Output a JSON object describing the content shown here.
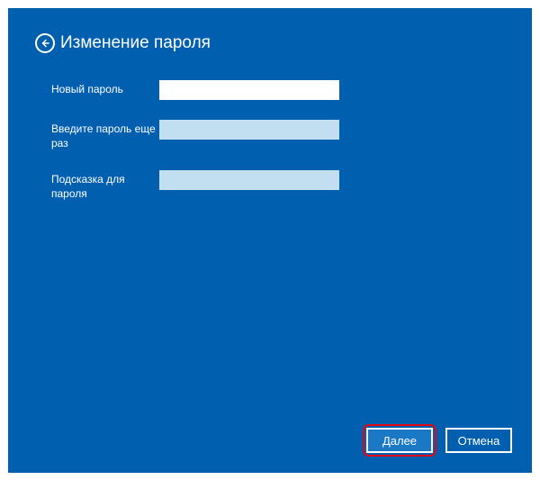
{
  "header": {
    "title": "Изменение пароля"
  },
  "form": {
    "new_password": {
      "label": "Новый пароль",
      "value": ""
    },
    "confirm_password": {
      "label": "Введите пароль еще раз",
      "value": ""
    },
    "hint": {
      "label": "Подсказка для пароля",
      "value": ""
    }
  },
  "buttons": {
    "next": "Далее",
    "cancel": "Отмена"
  }
}
